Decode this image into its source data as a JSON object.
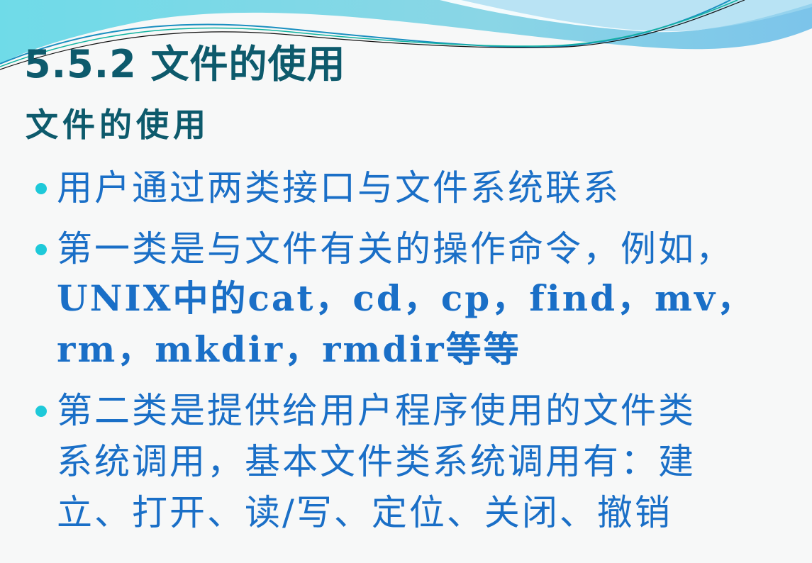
{
  "slide": {
    "title": "5.5.2 文件的使用",
    "subtitle": "文件的使用",
    "bullets": [
      {
        "lines": [
          "用户通过两类接口与文件系统联系"
        ]
      },
      {
        "lines": [
          "第一类是与文件有关的操作命令，例如，",
          "UNIX中的cat，cd，cp，find，mv，",
          "rm，mkdir，rmdir等等"
        ]
      },
      {
        "lines": [
          "第二类是提供给用户程序使用的文件类",
          "系统调用，基本文件类系统调用有：建",
          "立、打开、读/写、定位、关闭、撤销"
        ]
      }
    ]
  },
  "colors": {
    "title": "#0d5a6c",
    "text": "#1a6fc7",
    "bullet": "#1ec9d9"
  }
}
